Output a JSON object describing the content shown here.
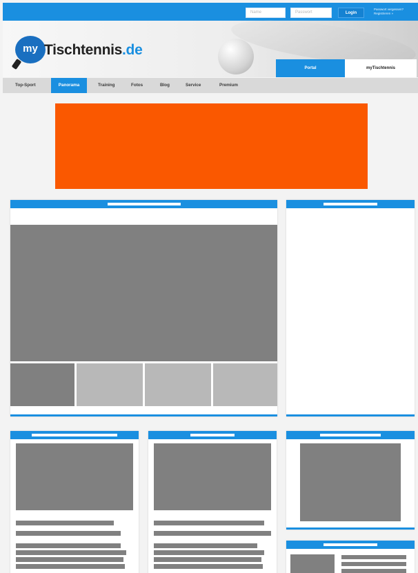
{
  "topbar": {
    "name_placeholder": "Name",
    "password_placeholder": "Passwort",
    "login_label": "Login",
    "forgot_label": "Passwort vergessen?",
    "register_label": "Registrieren »"
  },
  "header": {
    "logo_badge": "my",
    "logo_main": "Tischtennis",
    "logo_tld": ".de",
    "tab_portal": "Portal",
    "tab_my": "myTischtennis"
  },
  "nav": {
    "items": [
      "Top-Sport",
      "Panorama",
      "Training",
      "Fotos",
      "Blog",
      "Service",
      "Premium"
    ],
    "active_index": 1
  },
  "colors": {
    "brand_blue": "#1a8fe0",
    "ad_orange": "#fa5800",
    "placeholder_gray": "#808080",
    "thumb_light_gray": "#b8b8b8"
  }
}
